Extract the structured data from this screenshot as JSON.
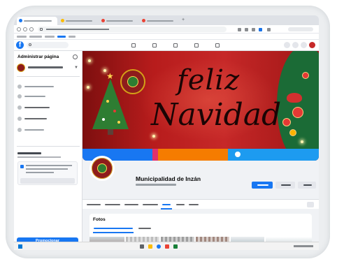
{
  "sidebar": {
    "title": "Administrar página",
    "promote_label": "Promocionar"
  },
  "cover": {
    "line1": "feliz",
    "line2": "Navidad",
    "social": [
      "",
      "",
      ""
    ]
  },
  "page": {
    "name": "Municipalidad de Inzán"
  },
  "photos": {
    "title": "Fotos"
  },
  "colors": {
    "facebook_blue": "#1877f2",
    "cover_red": "#c62828",
    "social_blue": "#1877f2",
    "social_pink": "#e1306c",
    "social_orange": "#f57c00",
    "social_twitter": "#1d9bf0"
  }
}
